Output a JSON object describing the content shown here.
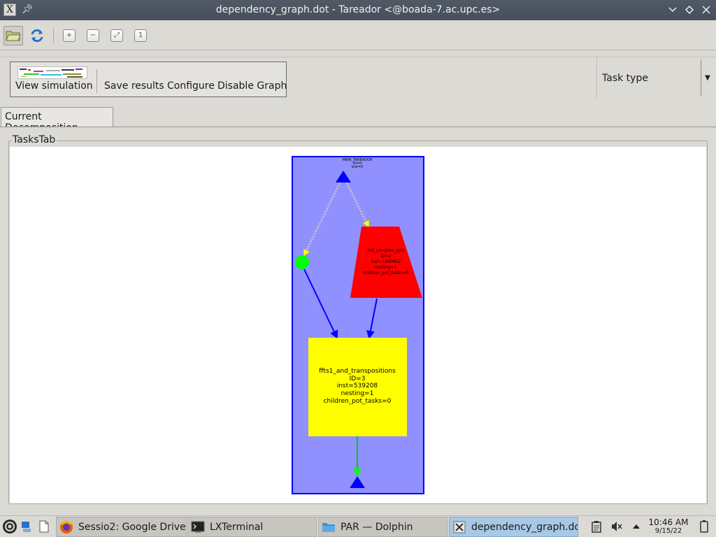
{
  "window": {
    "title": "dependency_graph.dot - Tareador <@boada-7.ac.upc.es>"
  },
  "toolbar": {
    "open_icon": "folder-open-icon",
    "reload_icon": "reload-icon",
    "zoom_in_icon": "zoom-in-icon",
    "zoom_out_icon": "zoom-out-icon",
    "zoom_fit_icon": "zoom-fit-icon",
    "zoom_reset_icon": "zoom-original-icon"
  },
  "actions": {
    "view_simulation": "View simulation",
    "save_results": "Save results",
    "configure": "Configure",
    "disable_graph": "Disable Graph",
    "task_type_label": "Task type"
  },
  "tabs": [
    {
      "label": "Current Decomposition",
      "active": true
    }
  ],
  "group_title": "TasksTab",
  "graph": {
    "background_color": "#9090ff",
    "nodes": [
      {
        "id": "start",
        "label_lines": [
          "MAIN_TAREADOR",
          "ID=0",
          "inst=0"
        ],
        "shape": "triangle",
        "color": "#0000ff"
      },
      {
        "id": "small_green",
        "label_lines": [
          "",
          "",
          ""
        ],
        "shape": "circle",
        "color": "#00ff00"
      },
      {
        "id": "init_complex_grid",
        "label_lines": [
          "init_complex_grid",
          "ID=2",
          "inst=1060452",
          "nesting=1",
          "children_pot_tasks=0"
        ],
        "shape": "trapezium",
        "color": "#ff0000"
      },
      {
        "id": "ffts1",
        "label_lines": [
          "ffts1_and_transpositions",
          "ID=3",
          "inst=539208",
          "nesting=1",
          "children_pot_tasks=0"
        ],
        "shape": "box",
        "color": "#ffff00"
      },
      {
        "id": "end",
        "label_lines": [],
        "shape": "triangle",
        "color": "#0000ff"
      }
    ],
    "edges": [
      {
        "from": "start",
        "to": "small_green",
        "style": "dotted",
        "color": "#b0b0b0"
      },
      {
        "from": "start",
        "to": "init_complex_grid",
        "style": "dotted",
        "color": "#b0b0b0"
      },
      {
        "from": "small_green",
        "to": "ffts1",
        "style": "solid",
        "color": "#0000ff"
      },
      {
        "from": "init_complex_grid",
        "to": "ffts1",
        "style": "solid",
        "color": "#0000ff"
      },
      {
        "from": "ffts1",
        "to": "end",
        "style": "solid",
        "color": "#00cc00"
      }
    ]
  },
  "taskbar": {
    "tasks": [
      {
        "label": "Sessio2: Google Drive ...",
        "icon": "firefox-icon",
        "active": false
      },
      {
        "label": "LXTerminal",
        "icon": "terminal-icon",
        "active": false
      },
      {
        "label": "PAR — Dolphin",
        "icon": "folder-icon",
        "active": false
      },
      {
        "label": "dependency_graph.do...",
        "icon": "tareador-icon",
        "active": true
      }
    ],
    "clock_time": "10:46 AM",
    "clock_date": "9/15/22"
  }
}
